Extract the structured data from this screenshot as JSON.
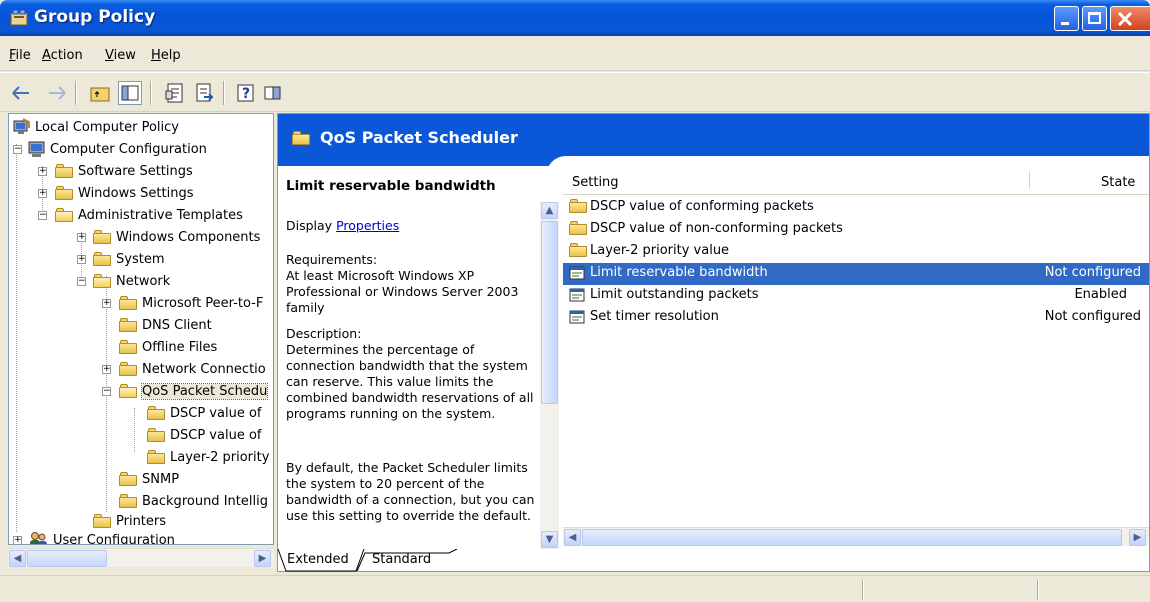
{
  "window": {
    "title": "Group Policy"
  },
  "menu": [
    {
      "key": "F",
      "rest": "ile"
    },
    {
      "key": "A",
      "rest": "ction"
    },
    {
      "key": "V",
      "rest": "iew"
    },
    {
      "key": "H",
      "rest": "elp"
    }
  ],
  "tree": {
    "root": "Local Computer Policy",
    "computer_configuration": "Computer Configuration",
    "software_settings": "Software Settings",
    "windows_settings": "Windows Settings",
    "administrative_templates": "Administrative Templates",
    "windows_components": "Windows Components",
    "system": "System",
    "network": "Network",
    "microsoft_peer": "Microsoft Peer-to-F",
    "dns_client": "DNS Client",
    "offline_files": "Offline Files",
    "network_connections": "Network Connectio",
    "qos_packet_scheduler": "QoS Packet Schedu",
    "dscp_1": "DSCP value of",
    "dscp_2": "DSCP value of",
    "layer2": "Layer-2 priority",
    "snmp": "SNMP",
    "background": "Background Intellig",
    "printers": "Printers",
    "user_configuration": "User Configuration"
  },
  "banner": {
    "title": "QoS Packet Scheduler"
  },
  "description": {
    "title": "Limit reservable bandwidth",
    "display_label": "Display",
    "properties_link": "Properties",
    "requirements_label": "Requirements:",
    "requirements_text": "At least Microsoft Windows XP Professional or Windows Server 2003 family",
    "description_label": "Description:",
    "description_text": "Determines the percentage of connection bandwidth that the system can reserve. This value limits the combined bandwidth reservations of all programs running on the system.",
    "default_text": "By default, the Packet Scheduler limits the system to 20 percent of the bandwidth of a connection, but you can use this setting to override the default."
  },
  "list": {
    "col_setting": "Setting",
    "col_state": "State",
    "rows": [
      {
        "name": "DSCP value of conforming packets",
        "state": "",
        "icon": "folder-icon"
      },
      {
        "name": "DSCP value of non-conforming packets",
        "state": "",
        "icon": "folder-icon"
      },
      {
        "name": "Layer-2 priority value",
        "state": "",
        "icon": "folder-icon"
      },
      {
        "name": "Limit reservable bandwidth",
        "state": "Not configured",
        "icon": "policy-setting-icon"
      },
      {
        "name": "Limit outstanding packets",
        "state": "Enabled",
        "icon": "policy-setting-icon"
      },
      {
        "name": "Set timer resolution",
        "state": "Not configured",
        "icon": "policy-setting-icon"
      }
    ]
  },
  "tabs": {
    "extended": "Extended",
    "standard": "Standard"
  },
  "colors": {
    "accent": "#0a58d8",
    "selection": "#316ac5"
  }
}
